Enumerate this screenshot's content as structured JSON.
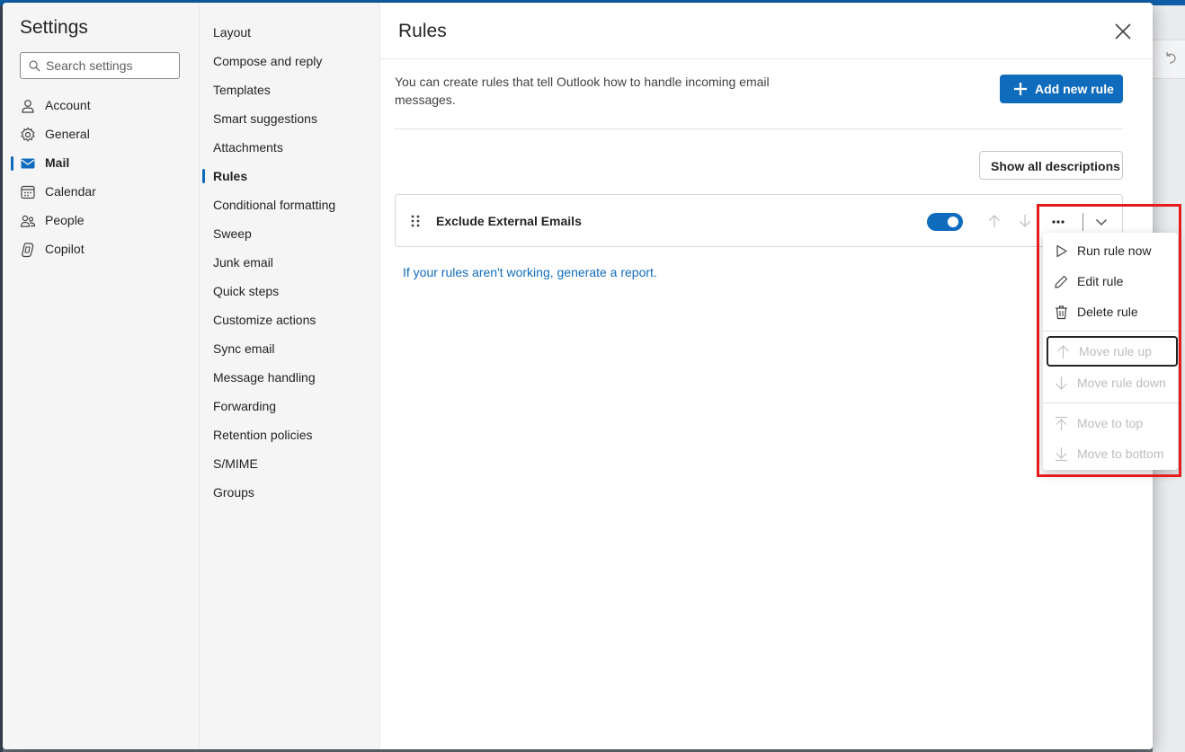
{
  "settings": {
    "title": "Settings",
    "search_placeholder": "Search settings",
    "categories": [
      {
        "label": "Account",
        "icon": "person-icon"
      },
      {
        "label": "General",
        "icon": "gear-icon"
      },
      {
        "label": "Mail",
        "icon": "mail-icon",
        "active": true
      },
      {
        "label": "Calendar",
        "icon": "calendar-icon"
      },
      {
        "label": "People",
        "icon": "people-icon"
      },
      {
        "label": "Copilot",
        "icon": "copilot-icon"
      }
    ],
    "mail_subsections": [
      "Layout",
      "Compose and reply",
      "Templates",
      "Smart suggestions",
      "Attachments",
      "Rules",
      "Conditional formatting",
      "Sweep",
      "Junk email",
      "Quick steps",
      "Customize actions",
      "Sync email",
      "Message handling",
      "Forwarding",
      "Retention policies",
      "S/MIME",
      "Groups"
    ],
    "active_subsection": "Rules"
  },
  "rules": {
    "title": "Rules",
    "description": "You can create rules that tell Outlook how to handle incoming email messages.",
    "add_button": "Add new rule",
    "show_descriptions_button": "Show all descriptions",
    "rule": {
      "name": "Exclude External Emails",
      "enabled": true
    },
    "report_link": "If your rules aren't working, generate a report."
  },
  "menu": {
    "items": [
      {
        "label": "Run rule now",
        "icon": "play-icon",
        "disabled": false
      },
      {
        "label": "Edit rule",
        "icon": "pencil-icon",
        "disabled": false
      },
      {
        "label": "Delete rule",
        "icon": "trash-icon",
        "disabled": false
      },
      {
        "label": "Move rule up",
        "icon": "arrow-up-icon",
        "disabled": true,
        "focused": true
      },
      {
        "label": "Move rule down",
        "icon": "arrow-down-icon",
        "disabled": true
      },
      {
        "label": "Move to top",
        "icon": "arrow-to-top-icon",
        "disabled": true
      },
      {
        "label": "Move to bottom",
        "icon": "arrow-to-bottom-icon",
        "disabled": true
      }
    ]
  },
  "colors": {
    "accent": "#0f6cbd",
    "highlight": "#e41c1c"
  }
}
